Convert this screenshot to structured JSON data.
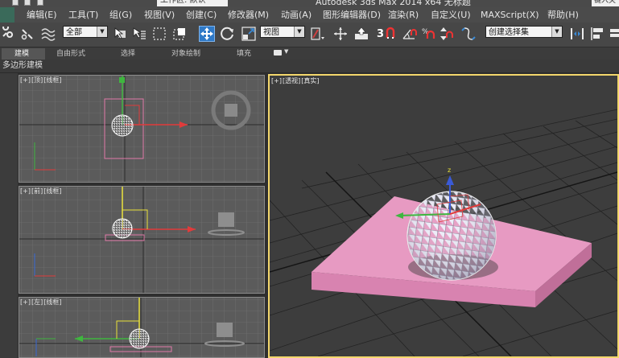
{
  "titlebar": {
    "workspace": "工作区: 默认",
    "title": "Autodesk 3ds Max  2014 x64    无标题",
    "search": "键入关"
  },
  "menus": [
    {
      "id": "edit",
      "label": "编辑(E)"
    },
    {
      "id": "tools",
      "label": "工具(T)"
    },
    {
      "id": "group",
      "label": "组(G)"
    },
    {
      "id": "views",
      "label": "视图(V)"
    },
    {
      "id": "create",
      "label": "创建(C)"
    },
    {
      "id": "modifiers",
      "label": "修改器(M)"
    },
    {
      "id": "animation",
      "label": "动画(A)"
    },
    {
      "id": "graph",
      "label": "图形编辑器(D)"
    },
    {
      "id": "render",
      "label": "渲染(R)"
    },
    {
      "id": "customize",
      "label": "自定义(U)"
    },
    {
      "id": "maxscript",
      "label": "MAXScript(X)"
    },
    {
      "id": "help",
      "label": "帮助(H)"
    }
  ],
  "toolbar": {
    "selection_filter": "全部",
    "ref_coord": "视图",
    "named_selection": "创建选择集",
    "snap_label": "3"
  },
  "ribbon": {
    "tabs": [
      "建模",
      "自由形式",
      "选择",
      "对象绘制",
      "填充"
    ]
  },
  "subbar": {
    "label": "多边形建模"
  },
  "viewports": {
    "top": [
      "[+]",
      "[顶]",
      "[线框]"
    ],
    "front": [
      "[+]",
      "[前]",
      "[线框]"
    ],
    "left": [
      "[+]",
      "[左]",
      "[线框]"
    ],
    "perspective": [
      "[+]",
      "[透视]",
      "[真实]"
    ]
  },
  "colors": {
    "active_border": "#f3d76c",
    "move_active": "#2f79c7",
    "plane": "#e79ac2"
  }
}
